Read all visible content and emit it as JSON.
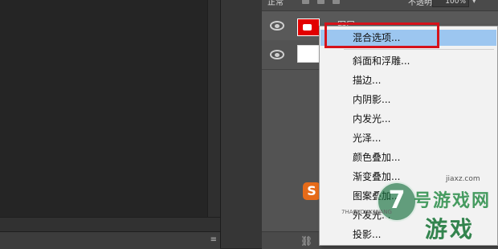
{
  "layers_panel": {
    "blend_mode": "正常",
    "opacity_label": "不透明度:",
    "opacity_value": "100%",
    "layers": [
      {
        "name": "图层"
      },
      {
        "name": ""
      }
    ],
    "bottom_fx": "fx"
  },
  "status_bar": {
    "menu_glyph": "≡"
  },
  "context_menu": {
    "items": [
      {
        "label": "混合选项..."
      },
      {
        "label": "斜面和浮雕..."
      },
      {
        "label": "描边..."
      },
      {
        "label": "内阴影..."
      },
      {
        "label": "内发光..."
      },
      {
        "label": "光泽..."
      },
      {
        "label": "颜色叠加..."
      },
      {
        "label": "渐变叠加..."
      },
      {
        "label": "图案叠加..."
      },
      {
        "label": "外发光..."
      },
      {
        "label": "投影..."
      }
    ]
  },
  "watermark": {
    "site": "jiaxz.com",
    "pinyin": "7HAOYOUXIWANG",
    "brand_line1": "号游戏网",
    "brand_line2": "游戏",
    "badge": "7"
  },
  "colors": {
    "highlight": "#9cc6f0",
    "callout_red": "#d6121a",
    "layer_thumb_red": "#e20000"
  }
}
